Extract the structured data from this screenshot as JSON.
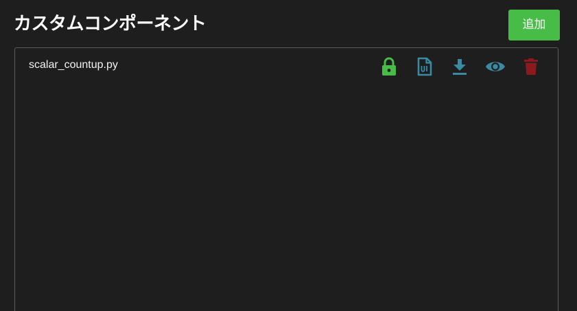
{
  "header": {
    "title": "カスタムコンポーネント",
    "add_label": "追加"
  },
  "components": [
    {
      "file_name": "scalar_countup.py",
      "actions": [
        {
          "icon": "lock-icon",
          "color": "#47bd47"
        },
        {
          "icon": "ui-file-icon",
          "color": "#3a8aa3"
        },
        {
          "icon": "download-icon",
          "color": "#3a8aa3"
        },
        {
          "icon": "eye-icon",
          "color": "#3a8aa3"
        },
        {
          "icon": "trash-icon",
          "color": "#8b1a1f"
        }
      ]
    }
  ],
  "colors": {
    "background": "#1e1e1e",
    "accent_green": "#47bd47",
    "icon_teal": "#3a8aa3",
    "delete_red": "#8b1a1f",
    "panel_border": "#5a5a5a"
  }
}
